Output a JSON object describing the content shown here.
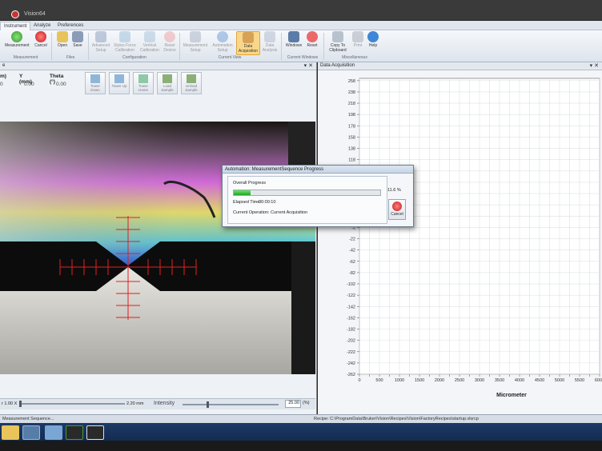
{
  "window": {
    "title": "Vision64"
  },
  "ribbon": {
    "tabs": [
      "Instrument",
      "Analyze",
      "Preferences"
    ],
    "groups": {
      "measurement": {
        "label": "Measurement",
        "buttons": [
          {
            "label": "Measurement",
            "icon": "play-icon"
          },
          {
            "label": "Cancel",
            "icon": "cancel-icon"
          }
        ]
      },
      "files": {
        "label": "Files",
        "buttons": [
          {
            "label": "Open",
            "icon": "folder-icon"
          },
          {
            "label": "Save",
            "icon": "save-icon"
          }
        ]
      },
      "configuration": {
        "label": "Configuration",
        "buttons": [
          {
            "label": "Advanced Setup",
            "icon": "wrench-icon"
          },
          {
            "label": "Stylus Force Calibration",
            "icon": "stylus-icon"
          },
          {
            "label": "Vertical Calibration",
            "icon": "vertical-cal-icon"
          },
          {
            "label": "Reset Device",
            "icon": "reset-device-icon"
          }
        ]
      },
      "current_view": {
        "label": "Current View",
        "buttons": [
          {
            "label": "Measurement Setup",
            "icon": "measure-setup-icon"
          },
          {
            "label": "Automation Setup",
            "icon": "automation-icon"
          },
          {
            "label": "Data Acquisition",
            "icon": "acquisition-icon"
          },
          {
            "label": "Data Analysis",
            "icon": "analysis-icon"
          }
        ]
      },
      "current_windows": {
        "label": "Current Windows",
        "buttons": [
          {
            "label": "Windows",
            "icon": "windows-icon"
          },
          {
            "label": "Reset",
            "icon": "power-icon"
          }
        ]
      },
      "miscellaneous": {
        "label": "Miscellaneous",
        "buttons": [
          {
            "label": "Copy To Clipboard",
            "icon": "clipboard-icon"
          },
          {
            "label": "Print",
            "icon": "printer-icon"
          },
          {
            "label": "Help",
            "icon": "help-icon"
          }
        ]
      }
    }
  },
  "left_panel": {
    "coords": [
      {
        "label": "m)",
        "value": "0"
      },
      {
        "label": "Y (mm)",
        "value": "0.00"
      },
      {
        "label": "Theta (°)",
        "value": "0.00"
      }
    ],
    "stage_buttons": [
      "Tower Down",
      "Tower Up",
      "Tower Home",
      "Load Sample",
      "Unload Sample"
    ],
    "zoom": {
      "left": "r 1.00 X",
      "right": "2.20 mm"
    },
    "intensity": {
      "label": "Intensity",
      "value": "25.00",
      "unit": "(%)",
      "level": 0.25
    }
  },
  "right_panel": {
    "title": "Data Acquisition",
    "chart_data": {
      "type": "line",
      "title": "",
      "xlabel": "Micrometer",
      "ylabel": "",
      "xlim": [
        0,
        6000
      ],
      "ylim": [
        -262,
        262
      ],
      "xticks": [
        "0",
        "250",
        "500",
        "750",
        "1000",
        "1250",
        "1500",
        "1750",
        "2000",
        "2250",
        "2500",
        "2750",
        "3000",
        "3250",
        "3500",
        "3750",
        "4000",
        "4250",
        "4500",
        "4750",
        "5000",
        "5250",
        "5500",
        "5750",
        "6000"
      ],
      "yticks": [
        "258",
        "238",
        "218",
        "198",
        "178",
        "158",
        "138",
        "118",
        "98",
        "78",
        "58",
        "38",
        "18",
        "-2",
        "-22",
        "-42",
        "-62",
        "-82",
        "-102",
        "-122",
        "-142",
        "-162",
        "-182",
        "-202",
        "-222",
        "-242",
        "-262"
      ],
      "x_tick_labels_shown": [
        "0",
        "500",
        "1000",
        "1500",
        "2000",
        "2500",
        "3000",
        "3500",
        "4000",
        "4500",
        "5000",
        "5500",
        "6000"
      ],
      "grid": true,
      "series": [
        {
          "x": [],
          "y": []
        }
      ]
    }
  },
  "dialog": {
    "title": "Automation: MeasurementSequence Progress",
    "overall_label": "Overall Progress",
    "progress_text": "11.6 %",
    "progress_value": 0.116,
    "elapsed_label": "Elapsed Time:",
    "elapsed_value": "00:00:10",
    "operation_label": "Current Operation:",
    "operation_value": "Current Acquisition",
    "cancel_label": "Cancel"
  },
  "status_bar": {
    "left": "Measurement Sequence...",
    "recipe": "Recipe: C:\\ProgramData\\Bruker\\Vision\\Recipes\\Vision\\FactoryRecipes\\startup.vlsrcp"
  },
  "colors": {
    "progress": "#1fa424",
    "crosshair": "#e02020",
    "accent": "#f9d78a"
  }
}
